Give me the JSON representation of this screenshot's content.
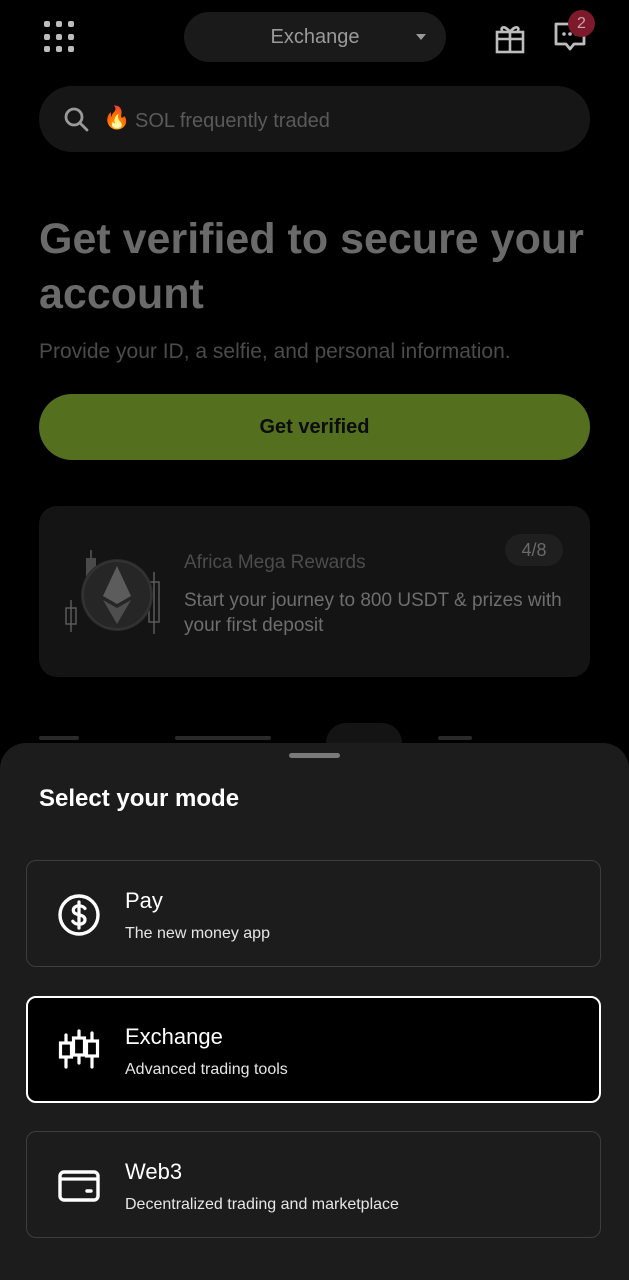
{
  "header": {
    "mode_label": "Exchange",
    "notification_count": "2"
  },
  "search": {
    "placeholder": "SOL frequently traded"
  },
  "hero": {
    "title": "Get verified to secure your account",
    "subtitle": "Provide your ID, a selfie, and personal information.",
    "button_label": "Get verified"
  },
  "promo": {
    "title": "Africa Mega Rewards",
    "body": "Start your journey to 800 USDT & prizes with your first deposit",
    "progress": "4/8"
  },
  "sheet": {
    "title": "Select your mode",
    "options": [
      {
        "title": "Pay",
        "description": "The new money app",
        "icon": "dollar-circle-icon",
        "selected": false
      },
      {
        "title": "Exchange",
        "description": "Advanced trading tools",
        "icon": "candlestick-icon",
        "selected": true
      },
      {
        "title": "Web3",
        "description": "Decentralized trading and marketplace",
        "icon": "wallet-icon",
        "selected": false
      }
    ]
  },
  "colors": {
    "accent": "#54701f",
    "sheet_bg": "#1c1c1c",
    "badge": "#7c1a2b"
  }
}
